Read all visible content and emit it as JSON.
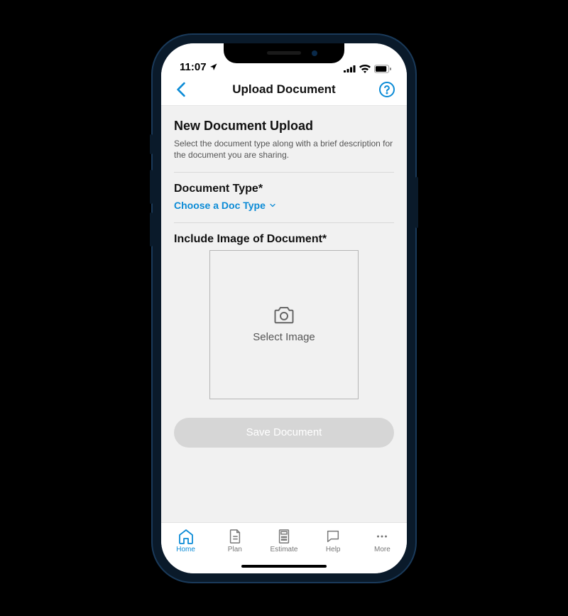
{
  "status": {
    "time": "11:07",
    "location_arrow": true
  },
  "nav": {
    "title": "Upload Document"
  },
  "content": {
    "heading": "New Document Upload",
    "description": "Select the document type along with a brief description for the document you are sharing.",
    "doc_type_label": "Document Type*",
    "doc_type_dropdown": "Choose a Doc Type",
    "image_section_label": "Include Image of Document*",
    "select_image_label": "Select Image",
    "save_button_label": "Save Document"
  },
  "tabs": {
    "items": [
      {
        "label": "Home"
      },
      {
        "label": "Plan"
      },
      {
        "label": "Estimate"
      },
      {
        "label": "Help"
      },
      {
        "label": "More"
      }
    ]
  },
  "colors": {
    "accent": "#0b8bd6",
    "heading": "#111111",
    "muted": "#777777"
  }
}
